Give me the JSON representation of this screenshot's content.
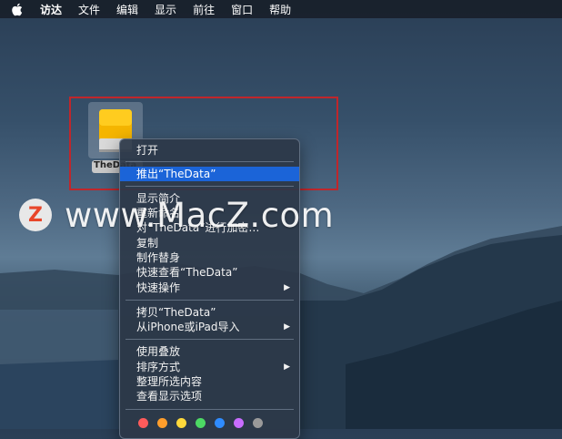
{
  "menubar": {
    "items": [
      "访达",
      "文件",
      "编辑",
      "显示",
      "前往",
      "窗口",
      "帮助"
    ]
  },
  "desktop": {
    "drive_label": "TheData"
  },
  "context_menu": {
    "items": [
      {
        "label": "打开"
      },
      {
        "label": "推出“TheData”",
        "selected": true
      },
      {
        "label": "显示简介"
      },
      {
        "label": "重新命名"
      },
      {
        "label": "对“TheData”进行加密…"
      },
      {
        "label": "复制"
      },
      {
        "label": "制作替身"
      },
      {
        "label": "快速查看“TheData”"
      },
      {
        "label": "快速操作",
        "submenu": true
      },
      {
        "label": "拷贝“TheData”"
      },
      {
        "label": "从iPhone或iPad导入",
        "submenu": true
      },
      {
        "label": "使用叠放"
      },
      {
        "label": "排序方式",
        "submenu": true
      },
      {
        "label": "整理所选内容"
      },
      {
        "label": "查看显示选项"
      }
    ],
    "tag_colors": [
      "#ff5b5b",
      "#ff9e2c",
      "#ffd93b",
      "#4cd964",
      "#2f8cff",
      "#c86dff",
      "#9a9a9a"
    ]
  },
  "watermark": {
    "text": "www.MacZ.com",
    "logo_letter": "Z"
  },
  "colors": {
    "selection": "#1b64d8",
    "highlight_box": "#c0262b"
  }
}
